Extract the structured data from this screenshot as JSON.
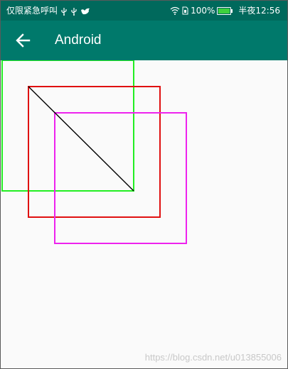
{
  "status_bar": {
    "left_text": "仅限紧急呼叫",
    "left_icons": [
      "usb-icon",
      "usb-icon",
      "bird-notification-icon"
    ],
    "wifi_icon": "wifi-icon",
    "sim_icon": "sim-card-icon",
    "battery_percent": "100%",
    "battery_level": 1.0,
    "battery_color": "#3dd13d",
    "time": "半夜12:56",
    "background": "#00695c"
  },
  "app_bar": {
    "back_icon": "arrow-left-icon",
    "title": "Android",
    "background": "#00796b"
  },
  "canvas": {
    "background": "#fafafa",
    "shapes": [
      {
        "name": "green-rectangle",
        "color": "#22ee22"
      },
      {
        "name": "red-rectangle",
        "color": "#e01010"
      },
      {
        "name": "magenta-rectangle",
        "color": "#ee22ee"
      },
      {
        "name": "black-diagonal-line",
        "color": "#000000"
      }
    ]
  },
  "watermark": {
    "text": "https://blog.csdn.net/u013855006"
  }
}
